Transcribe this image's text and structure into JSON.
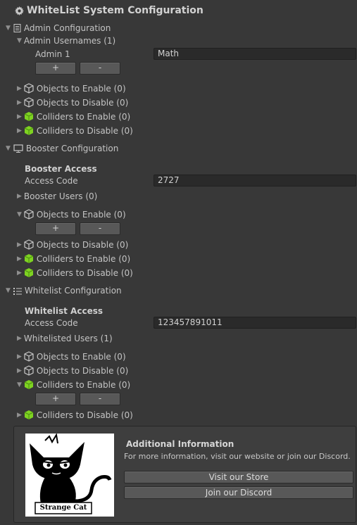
{
  "title": "WhiteList System Configuration",
  "admin": {
    "header": "Admin Configuration",
    "usernames_label": "Admin Usernames (1)",
    "admin1_label": "Admin 1",
    "admin1_value": "Math",
    "plus": "+",
    "minus": "-",
    "objects_enable": "Objects to Enable (0)",
    "objects_disable": "Objects to Disable (0)",
    "colliders_enable": "Colliders to Enable (0)",
    "colliders_disable": "Colliders to Disable (0)"
  },
  "booster": {
    "header": "Booster Configuration",
    "access_heading": "Booster Access",
    "access_code_label": "Access Code",
    "access_code_value": "2727",
    "users_label": "Booster Users (0)",
    "objects_enable": "Objects to Enable (0)",
    "plus": "+",
    "minus": "-",
    "objects_disable": "Objects to Disable (0)",
    "colliders_enable": "Colliders to Enable (0)",
    "colliders_disable": "Colliders to Disable (0)"
  },
  "whitelist": {
    "header": "Whitelist Configuration",
    "access_heading": "Whitelist Access",
    "access_code_label": "Access Code",
    "access_code_value": "123457891011",
    "users_label": "Whitelisted Users (1)",
    "objects_enable": "Objects to Enable (0)",
    "objects_disable": "Objects to Disable (0)",
    "colliders_enable": "Colliders to Enable (0)",
    "plus": "+",
    "minus": "-",
    "colliders_disable": "Colliders to Disable (0)"
  },
  "info": {
    "heading": "Additional Information",
    "text": "For more information, visit our website or join our Discord.",
    "store_button": "Visit our Store",
    "discord_button": "Join our Discord",
    "logo_text": "Strange Cat"
  },
  "colors": {
    "background": "#383838",
    "field": "#2a2a2a",
    "button": "#585858",
    "collider_green": "#7ed321"
  }
}
